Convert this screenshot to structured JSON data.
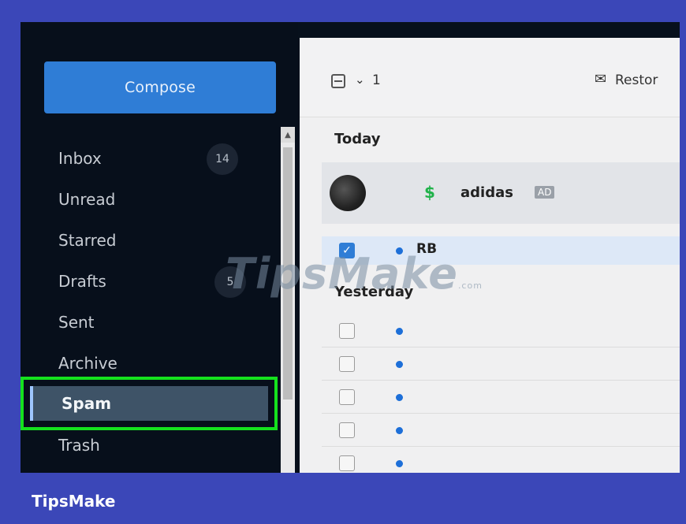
{
  "sidebar": {
    "compose_label": "Compose",
    "items": [
      {
        "label": "Inbox",
        "count": "14"
      },
      {
        "label": "Unread"
      },
      {
        "label": "Starred"
      },
      {
        "label": "Drafts",
        "count": "5"
      },
      {
        "label": "Sent"
      },
      {
        "label": "Archive"
      },
      {
        "label": "Spam",
        "selected": true
      },
      {
        "label": "Trash"
      }
    ]
  },
  "toolbar": {
    "selected_count": "1",
    "restore_label": "Restor"
  },
  "messages": {
    "today_header": "Today",
    "yesterday_header": "Yesterday",
    "ad_sender": "adidas",
    "ad_badge": "AD",
    "rb_sender": "RB",
    "yesterday_rows": 5
  },
  "watermark": {
    "text": "TipsMake",
    "suffix": ".com"
  },
  "footer": {
    "brand": "TipsMake"
  },
  "colors": {
    "accent": "#2f7dd6",
    "highlight_border": "#15e21e",
    "unread_dot": "#1d6fd8",
    "page_background": "#3b47b8"
  },
  "icons": [
    "chevron-down-icon",
    "restore-icon",
    "dollar-icon",
    "checkmark-icon",
    "scroll-up-icon"
  ]
}
